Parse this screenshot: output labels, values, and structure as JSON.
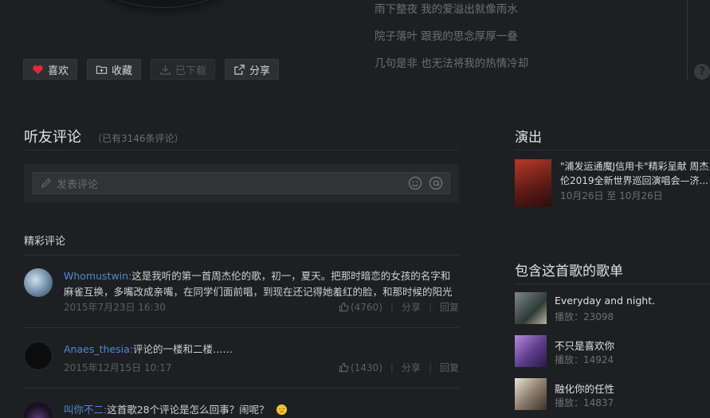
{
  "lyrics": [
    "雨下整夜 我的爱溢出就像雨水",
    "院子落叶 跟我的思念厚厚一叠",
    "几句是非 也无法将我的热情冷却"
  ],
  "help_label": "?",
  "actions": {
    "like": "喜欢",
    "collect": "收藏",
    "download": "已下载",
    "share": "分享"
  },
  "comments_section": {
    "title": "听友评论",
    "count": "（已有3146条评论）",
    "input_placeholder": "发表评论",
    "featured_label": "精彩评论"
  },
  "comments": [
    {
      "user": "Whomustwin:",
      "text": "这是我听的第一首周杰伦的歌，初一，夏天。把那时暗恋的女孩的名字和麻雀互换，多嘴改成亲嘴，在同学们面前唱，到现在还记得她羞红的脸，和那时候的阳光",
      "time": "2015年7月23日 16:30",
      "likes": "(4760)",
      "share": "分享",
      "reply": "回复"
    },
    {
      "user": "Anaes_thesia:",
      "text": "评论的一楼和二楼……",
      "time": "2015年12月15日 10:17",
      "likes": "(1430)",
      "share": "分享",
      "reply": "回复"
    },
    {
      "user": "叫你不二:",
      "text": "这首歌28个评论是怎么回事？闹呢？"
    }
  ],
  "sep": "|",
  "performance": {
    "title": "演出",
    "text": "\"浦发运通魔J信用卡\"精彩呈献 周杰伦2019全新世界巡回演唱会—济...",
    "date": "10月26日 至 10月26日"
  },
  "playlists_section": {
    "title": "包含这首歌的歌单"
  },
  "playlists": [
    {
      "name": "Everyday and night.",
      "plays": "播放：23098"
    },
    {
      "name": "不只是喜欢你",
      "plays": "播放：14924"
    },
    {
      "name": "融化你的任性",
      "plays": "播放：14837"
    }
  ],
  "colors": {
    "background": "#1e1f22",
    "link": "#4e8bd2",
    "heart": "#e0293a"
  }
}
